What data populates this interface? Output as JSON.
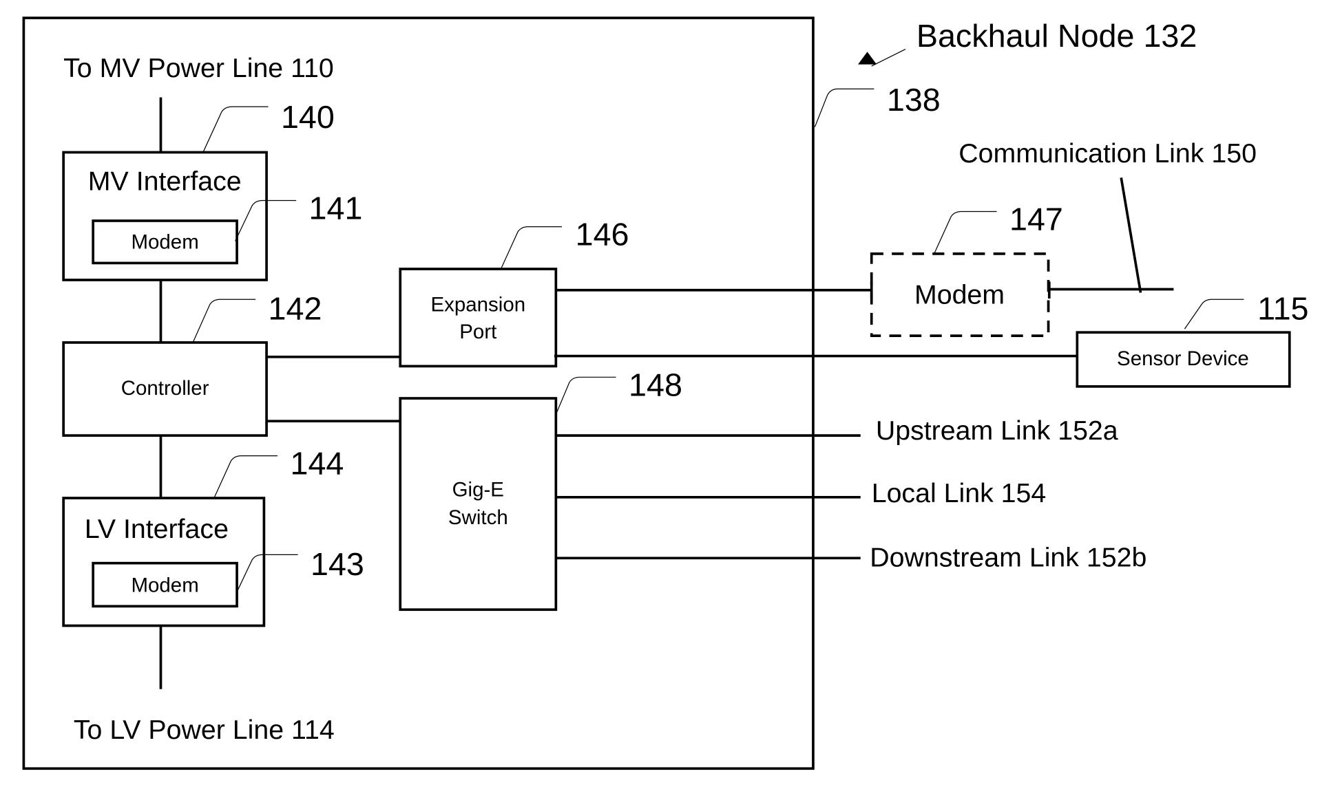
{
  "diagram": {
    "title": "Backhaul Node 132",
    "enclosure_ref": "138",
    "external_labels": {
      "mv_power_line": "To MV Power Line 110",
      "lv_power_line": "To LV Power Line 114",
      "communication_link": "Communication Link 150",
      "upstream_link": "Upstream Link 152a",
      "local_link": "Local Link 154",
      "downstream_link": "Downstream Link 152b"
    },
    "blocks": {
      "mv_interface": {
        "label": "MV Interface",
        "ref": "140"
      },
      "mv_modem": {
        "label": "Modem",
        "ref": "141"
      },
      "controller": {
        "label": "Controller",
        "ref": "142"
      },
      "lv_interface": {
        "label": "LV Interface",
        "ref": "144"
      },
      "lv_modem": {
        "label": "Modem",
        "ref": "143"
      },
      "expansion_port": {
        "label_line1": "Expansion",
        "label_line2": "Port",
        "ref": "146"
      },
      "gige_switch": {
        "label_line1": "Gig-E",
        "label_line2": "Switch",
        "ref": "148"
      },
      "ext_modem": {
        "label": "Modem",
        "ref": "147",
        "style": "dashed"
      },
      "sensor_device": {
        "label": "Sensor Device",
        "ref": "115"
      }
    }
  }
}
